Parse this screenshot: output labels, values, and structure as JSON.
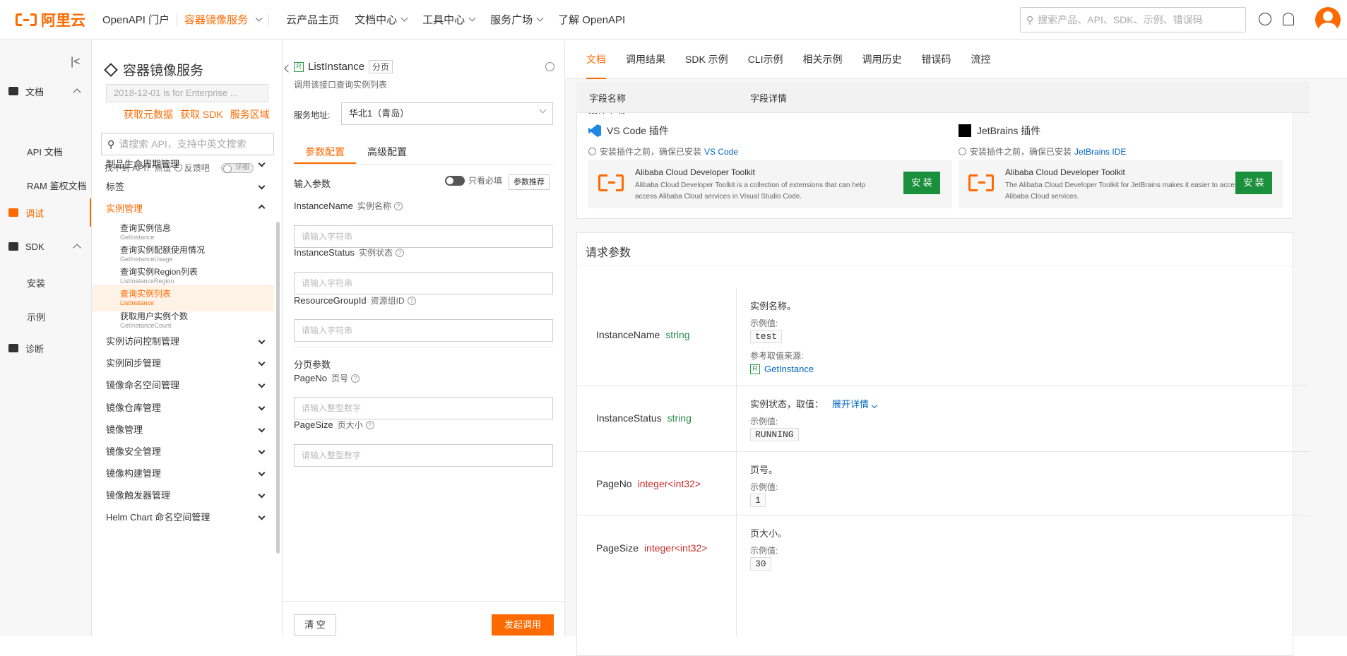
{
  "topbar": {
    "brand": "阿里云",
    "portal": "OpenAPI 门户",
    "product": "容器镜像服务",
    "nav": [
      "云产品主页",
      "文档中心",
      "工具中心",
      "服务广场",
      "了解 OpenAPI"
    ],
    "search_placeholder": "搜索产品、API、SDK、示例、错误码"
  },
  "leftnav": {
    "doc": "文档",
    "api_doc": "API 文档",
    "ram_doc": "RAM 鉴权文档",
    "debug": "调试",
    "sdk": "SDK",
    "install": "安装",
    "example": "示例",
    "diagnose": "诊断"
  },
  "apicol": {
    "title": "容器镜像服务",
    "version": "2018-12-01 is for Enterprise ...",
    "links": [
      "获取元数据",
      "获取 SDK",
      "服务区域"
    ],
    "search_placeholder": "请搜索 API，支持中英文搜索",
    "hint": "找不到 API？点击",
    "feedback": "反馈吧",
    "detail": "详细",
    "groups": {
      "g1": "制品生命周期管理",
      "g2": "标签",
      "g3": "实例管理",
      "g4": "实例访问控制管理",
      "g5": "实例同步管理",
      "g6": "镜像命名空间管理",
      "g7": "镜像仓库管理",
      "g8": "镜像管理",
      "g9": "镜像安全管理",
      "g10": "镜像构建管理",
      "g11": "镜像触发器管理",
      "g12": "Helm Chart 命名空间管理"
    },
    "leaves": [
      {
        "cn": "查询实例信息",
        "en": "GetInstance"
      },
      {
        "cn": "查询实例配额使用情况",
        "en": "GetInstanceUsage"
      },
      {
        "cn": "查询实例Region列表",
        "en": "ListInstanceRegion"
      },
      {
        "cn": "查询实例列表",
        "en": "ListInstance"
      },
      {
        "cn": "获取用户实例个数",
        "en": "GetInstanceCount"
      }
    ]
  },
  "params": {
    "api_name": "ListInstance",
    "tag": "分页",
    "desc": "调用该接口查询实例列表",
    "svc_label": "服务地址:",
    "svc_value": "华北1（青岛）",
    "tab1": "参数配置",
    "tab2": "高级配置",
    "input_params": "输入参数",
    "only_required": "只看必填",
    "recommend": "参数推荐",
    "fields": [
      {
        "name": "InstanceName",
        "cn": "实例名称",
        "placeholder": "请输入字符串"
      },
      {
        "name": "InstanceStatus",
        "cn": "实例状态",
        "placeholder": "请输入字符串"
      },
      {
        "name": "ResourceGroupId",
        "cn": "资源组ID",
        "placeholder": "请输入字符串"
      }
    ],
    "paging": "分页参数",
    "paging_fields": [
      {
        "name": "PageNo",
        "cn": "页号",
        "placeholder": "请输入整型数字"
      },
      {
        "name": "PageSize",
        "cn": "页大小",
        "placeholder": "请输入整型数字"
      }
    ],
    "clear": "清 空",
    "call": "发起调用"
  },
  "doc": {
    "tabs": [
      "文档",
      "调用结果",
      "SDK 示例",
      "CLI示例",
      "相关示例",
      "调用历史",
      "错误码",
      "流控"
    ],
    "plugin_title": "插件下载",
    "vscode": {
      "head": "VS Code 插件",
      "note": "安装插件之前，确保已安装",
      "link": "VS Code",
      "name": "Alibaba Cloud Developer Toolkit",
      "desc": "Alibaba Cloud Developer Toolkit is a collection of extensions that can help access Alibaba Cloud services in Visual Studio Code."
    },
    "jetbrains": {
      "head": "JetBrains 插件",
      "note": "安装插件之前，确保已安装",
      "link": "JetBrains IDE",
      "name": "Alibaba Cloud Developer Toolkit",
      "desc": "The Alibaba Cloud Developer Toolkit for JetBrains makes it easier to access Alibaba Cloud services."
    },
    "install": "安 装",
    "req_title": "请求参数",
    "col_name": "字段名称",
    "col_detail": "字段详情",
    "example_label": "示例值:",
    "ref_label": "参考取值来源:",
    "rows": [
      {
        "name": "InstanceName",
        "type": "string",
        "desc": "实例名称。",
        "example": "test",
        "ref": "GetInstance"
      },
      {
        "name": "InstanceStatus",
        "type": "string",
        "desc": "实例状态，取值：",
        "expand": "展开详情",
        "example": "RUNNING"
      },
      {
        "name": "PageNo",
        "type": "integer<int32>",
        "desc": "页号。",
        "example": "1"
      },
      {
        "name": "PageSize",
        "type": "integer<int32>",
        "desc": "页大小。",
        "example": "30"
      }
    ]
  },
  "colors": {
    "accent": "#ff6a00",
    "link": "#0064c8",
    "install": "#1a8f3c"
  }
}
